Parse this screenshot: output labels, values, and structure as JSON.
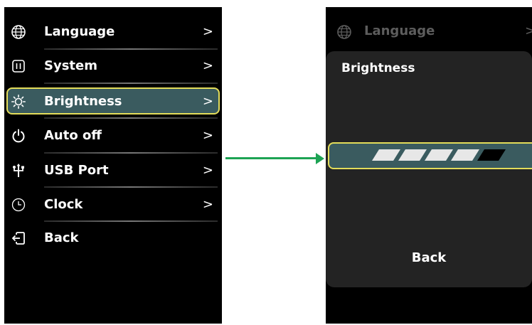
{
  "settings_menu": {
    "items": [
      {
        "label": "Language",
        "icon": "globe-icon",
        "chevron": ">"
      },
      {
        "label": "System",
        "icon": "system-icon",
        "chevron": ">"
      },
      {
        "label": "Brightness",
        "icon": "sun-icon",
        "chevron": ">",
        "selected": true
      },
      {
        "label": "Auto off",
        "icon": "power-icon",
        "chevron": ">"
      },
      {
        "label": "USB Port",
        "icon": "usb-icon",
        "chevron": ">"
      },
      {
        "label": "Clock",
        "icon": "clock-icon",
        "chevron": ">"
      },
      {
        "label": "Back",
        "icon": "back-icon",
        "chevron": ""
      }
    ]
  },
  "brightness_screen": {
    "dimmed_header": {
      "label": "Language",
      "icon": "globe-icon",
      "chevron": ">"
    },
    "title": "Brightness",
    "level": 4,
    "level_max": 5,
    "back_label": "Back"
  },
  "colors": {
    "background": "#000000",
    "highlight_fill": "#3a5b5f",
    "highlight_border": "#e3dc5a",
    "panel": "#232323",
    "dim_text": "#5d5d5d",
    "arrow": "#1da354",
    "segment_on": "#e7e7e7",
    "segment_off": "#000000"
  }
}
